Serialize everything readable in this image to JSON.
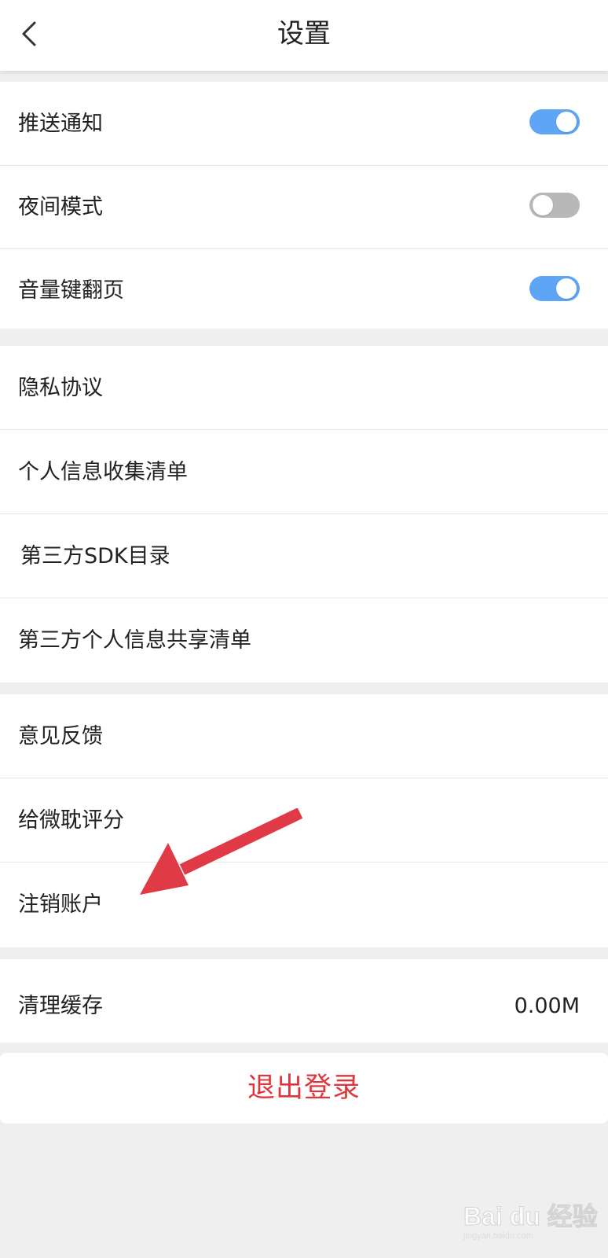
{
  "header": {
    "title": "设置"
  },
  "switches_group": [
    {
      "label": "推送通知",
      "state": "on"
    },
    {
      "label": "夜间模式",
      "state": "off"
    },
    {
      "label": "音量键翻页",
      "state": "on"
    }
  ],
  "info_group": [
    {
      "label": "隐私协议"
    },
    {
      "label": "个人信息收集清单"
    },
    {
      "label": "第三方SDK目录"
    },
    {
      "label": "第三方个人信息共享清单"
    }
  ],
  "account_group": [
    {
      "label": "意见反馈"
    },
    {
      "label": "给微耽评分"
    },
    {
      "label": "注销账户"
    }
  ],
  "cache": {
    "label": "清理缓存",
    "value": "0.00M"
  },
  "logout": {
    "label": "退出登录"
  },
  "colors": {
    "toggle_on": "#5ea6f5",
    "toggle_off": "#b8b8b8",
    "logout_text": "#e0353d",
    "annotation_arrow": "#e03a47",
    "background": "#efefef"
  },
  "watermark": {
    "text": "Bai du 经验",
    "sub": "jingyan.baidu.com"
  }
}
